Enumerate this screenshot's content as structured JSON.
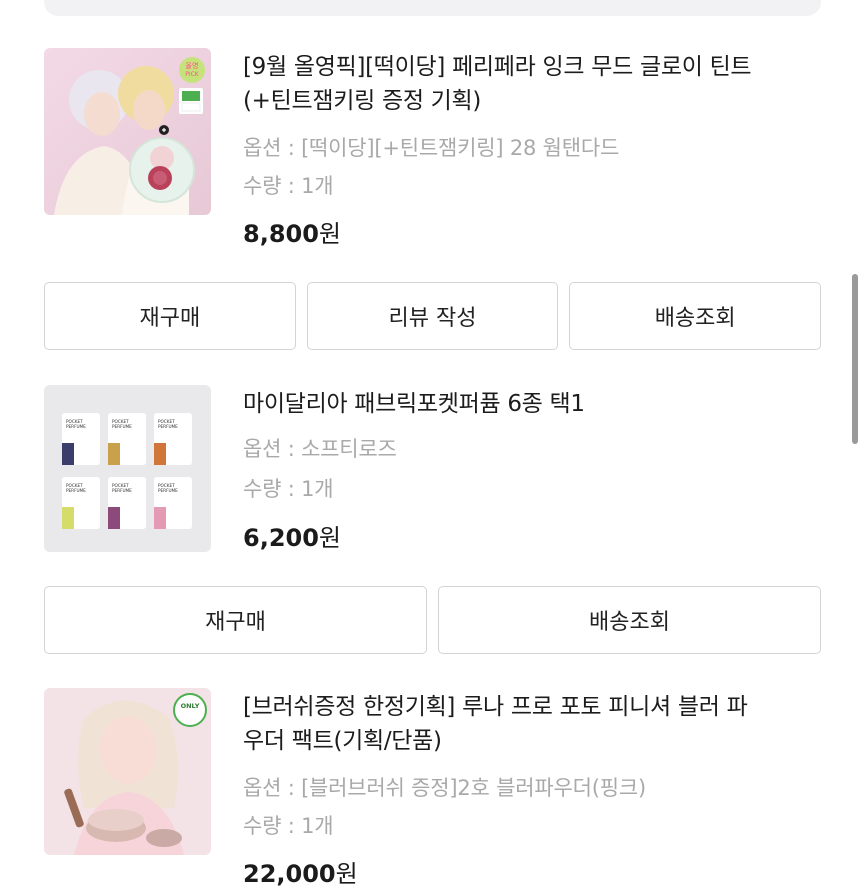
{
  "orders": [
    {
      "title": "[9월 올영픽][떡이당] 페리페라 잉크 무드 글로이 틴트 (+틴트잼키링 증정 기획)",
      "option": "옵션 : [떡이당][+틴트잼키링] 28 웜탠다드",
      "quantity": "수량 : 1개",
      "price_value": "8,800",
      "price_unit": "원",
      "image_badge": "올영 PICK",
      "buttons": [
        "재구매",
        "리뷰 작성",
        "배송조회"
      ]
    },
    {
      "title": "마이달리아 패브릭포켓퍼퓸 6종 택1",
      "option": "옵션 : 소프티로즈",
      "quantity": "수량 : 1개",
      "price_value": "6,200",
      "price_unit": "원",
      "image_label": "POCKET PERFUME",
      "buttons": [
        "재구매",
        "배송조회"
      ]
    },
    {
      "title": "[브러쉬증정 한정기획] 루나 프로 포토 피니셔 블러 파우더 팩트(기획/단품)",
      "option": "옵션 : [블러브러쉬 증정]2호 블러파우더(핑크)",
      "quantity": "수량 : 1개",
      "image_badge": "ONLY",
      "price_value": "22,000",
      "price_unit": "원"
    }
  ],
  "colors": {
    "text_primary": "#1c1c1c",
    "text_secondary": "#a9a9a9",
    "button_border": "#d4d4d4",
    "background": "#ffffff"
  }
}
